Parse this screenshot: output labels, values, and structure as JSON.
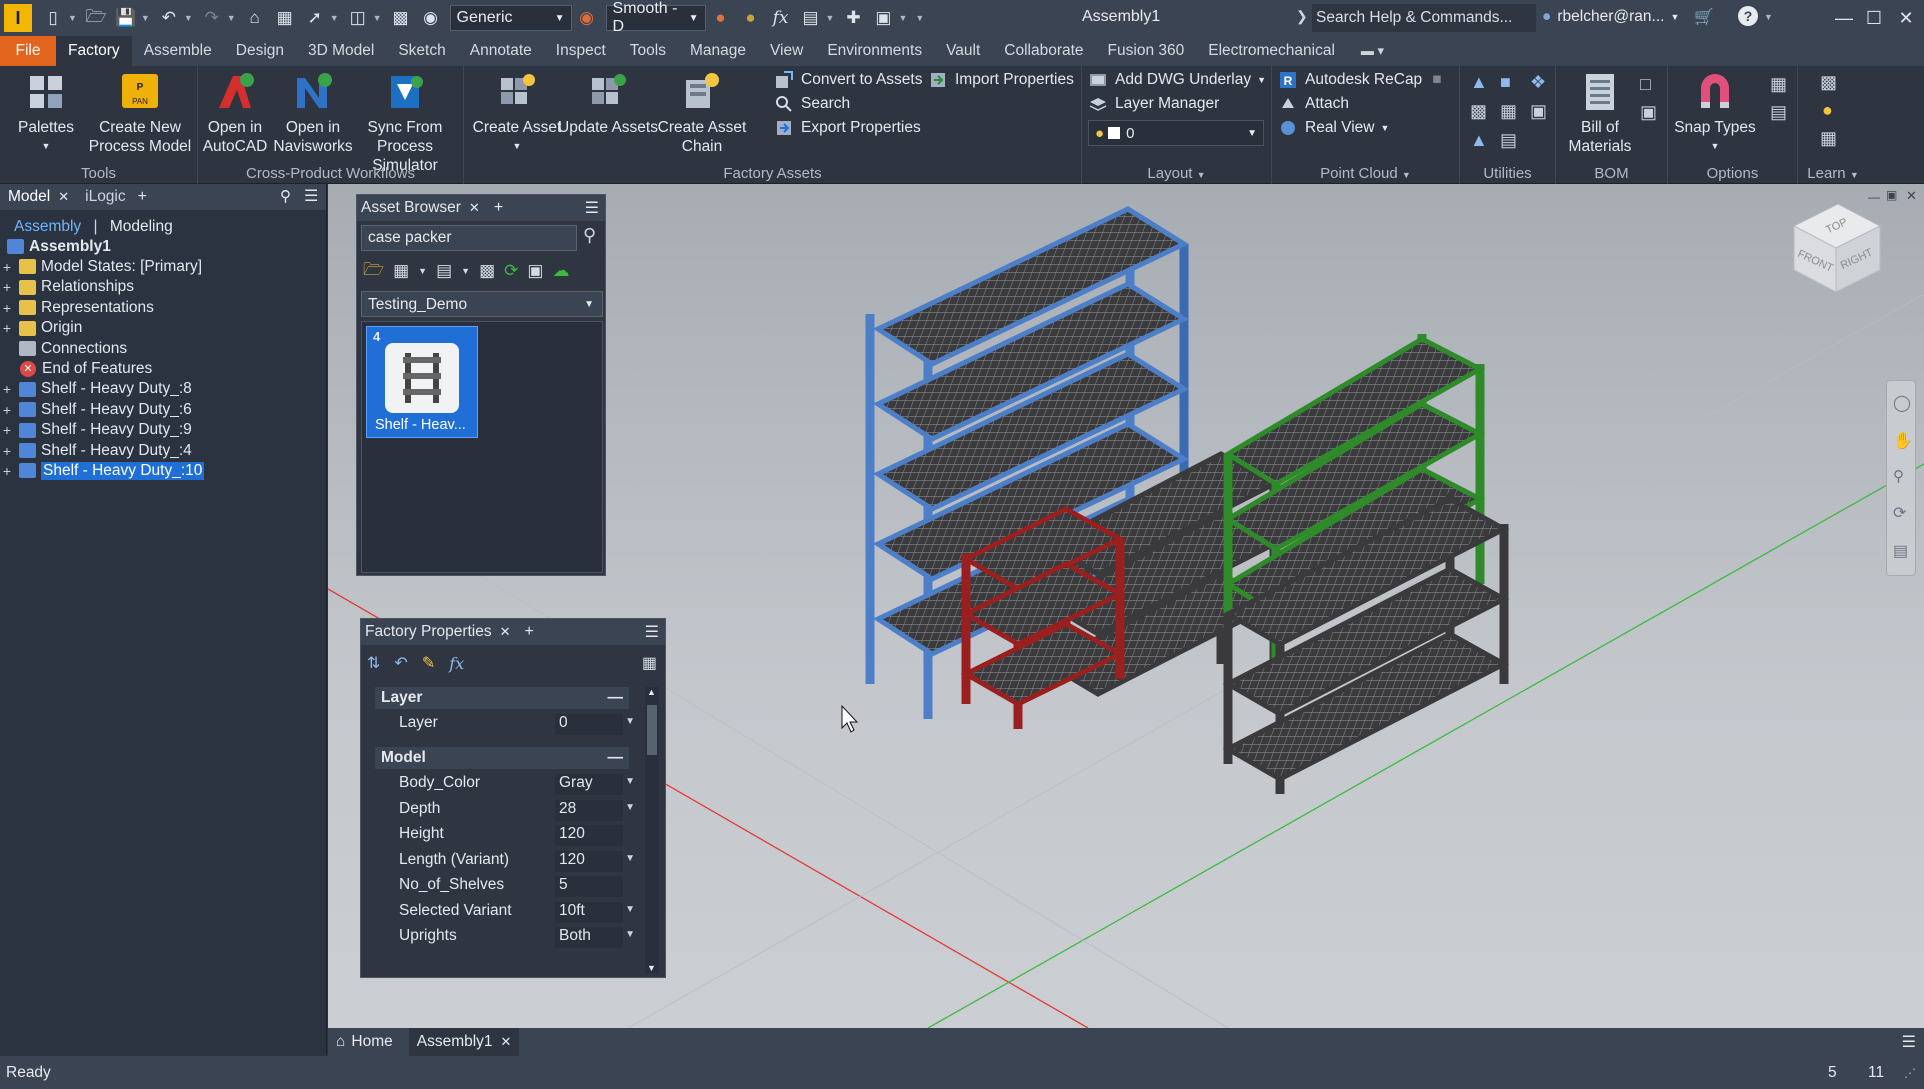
{
  "titlebar": {
    "appearance_combo": "Generic",
    "visual_style_combo": "Smooth - D",
    "doc_title": "Assembly1",
    "search_placeholder": "Search Help & Commands...",
    "user": "rbelcher@ran..."
  },
  "ribbon_tabs": [
    "File",
    "Factory",
    "Assemble",
    "Design",
    "3D Model",
    "Sketch",
    "Annotate",
    "Inspect",
    "Tools",
    "Manage",
    "View",
    "Environments",
    "Vault",
    "Collaborate",
    "Fusion 360",
    "Electromechanical"
  ],
  "active_tab": "Factory",
  "ribbon": {
    "tools": {
      "title": "Tools",
      "palettes": "Palettes",
      "create_process_model_1": "Create New",
      "create_process_model_2": "Process Model"
    },
    "cross_product": {
      "title": "Cross-Product Workflows",
      "autocad_1": "Open in",
      "autocad_2": "AutoCAD",
      "navisworks_1": "Open in",
      "navisworks_2": "Navisworks",
      "sync_1": "Sync From",
      "sync_2": "Process Simulator"
    },
    "factory_assets": {
      "title": "Factory Assets",
      "create_asset": "Create Asset",
      "update_assets": "Update Assets",
      "create_chain_1": "Create Asset",
      "create_chain_2": "Chain",
      "convert": "Convert to Assets",
      "import_props": "Import Properties",
      "search": "Search",
      "export_props": "Export Properties"
    },
    "layout": {
      "title": "Layout",
      "add_dwg": "Add DWG Underlay",
      "layer_manager": "Layer Manager",
      "layer_value": "0"
    },
    "point_cloud": {
      "title": "Point Cloud",
      "recap": "Autodesk  ReCap",
      "attach": "Attach",
      "real_view": "Real View"
    },
    "utilities": {
      "title": "Utilities"
    },
    "bom": {
      "title": "BOM",
      "bom_1": "Bill of",
      "bom_2": "Materials"
    },
    "options": {
      "title": "Options",
      "snap_types": "Snap Types"
    },
    "learn": {
      "title": "Learn"
    }
  },
  "browser": {
    "tab_model": "Model",
    "tab_ilogic": "iLogic",
    "view_assembly": "Assembly",
    "view_modeling": "Modeling",
    "tree": [
      {
        "label": "Assembly1",
        "bold": true
      },
      {
        "label": "Model States: [Primary]"
      },
      {
        "label": "Relationships"
      },
      {
        "label": "Representations"
      },
      {
        "label": "Origin"
      },
      {
        "label": "Connections"
      },
      {
        "label": "End of Features"
      },
      {
        "label": "Shelf - Heavy Duty_:8"
      },
      {
        "label": "Shelf - Heavy Duty_:6"
      },
      {
        "label": "Shelf - Heavy Duty_:9"
      },
      {
        "label": "Shelf - Heavy Duty_:4"
      },
      {
        "label": "Shelf - Heavy Duty_:10",
        "selected": true
      }
    ]
  },
  "asset_browser": {
    "title": "Asset Browser",
    "search_value": "case packer",
    "library": "Testing_Demo",
    "asset_count": "4",
    "asset_label": "Shelf - Heav..."
  },
  "factory_properties": {
    "title": "Factory Properties",
    "section_layer": "Layer",
    "layer_name": "Layer",
    "layer_value": "0",
    "section_model": "Model",
    "rows": [
      {
        "name": "Body_Color",
        "value": "Gray",
        "dropdown": true
      },
      {
        "name": "Depth",
        "value": "28",
        "dropdown": true
      },
      {
        "name": "Height",
        "value": "120",
        "dropdown": false
      },
      {
        "name": "Length (Variant)",
        "value": "120",
        "dropdown": true
      },
      {
        "name": "No_of_Shelves",
        "value": "5",
        "dropdown": false
      },
      {
        "name": "Selected Variant",
        "value": "10ft",
        "dropdown": true
      },
      {
        "name": "Uprights",
        "value": "Both",
        "dropdown": true
      }
    ]
  },
  "viewcube": {
    "top": "TOP",
    "front": "FRONT",
    "right": "RIGHT"
  },
  "doc_tabs": {
    "home": "Home",
    "assembly": "Assembly1"
  },
  "status": {
    "text": "Ready",
    "count1": "5",
    "count2": "11"
  },
  "colors": {
    "accent": "#e3651d",
    "blue_shelf": "#3f6fb4",
    "green_shelf": "#2f8a2a",
    "red_shelf": "#9a1f1f",
    "dark_shelf": "#3a3a3c",
    "selection": "#1f6fd6"
  }
}
